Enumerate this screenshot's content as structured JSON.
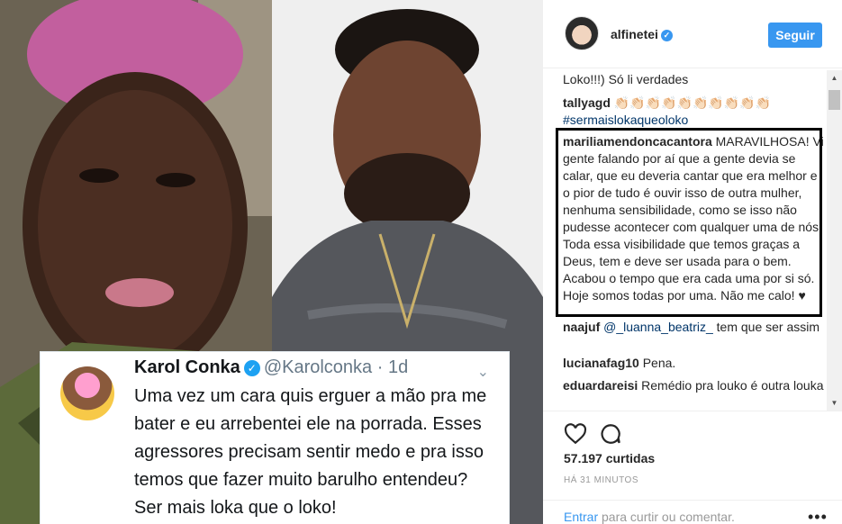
{
  "header": {
    "username": "alfinetei",
    "follow_label": "Seguir"
  },
  "tweet": {
    "name": "Karol Conka",
    "handle": "@Karolconka",
    "time": "· 1d",
    "text": "Uma vez um cara quis erguer a mão pra me bater e eu arrebentei ele na porrada. Esses agressores precisam sentir medo e pra isso temos que fazer muito barulho entendeu? Ser mais loka que o loko!"
  },
  "comments": [
    {
      "user": "",
      "text": "Loko!!!) Só li verdades"
    },
    {
      "user": "tallyagd",
      "text": "👏🏻👏🏻👏🏻👏🏻👏🏻👏🏻👏🏻👏🏻👏🏻👏🏻",
      "tag": "#sermaislokaqueoloko"
    },
    {
      "user": "mariliamendoncacantora",
      "text": "MARAVILHOSA! Vi gente falando por aí que a gente devia se calar, que eu deveria cantar que era melhor e o pior de tudo é ouvir isso de outra mulher, nenhuma sensibilidade, como se isso não pudesse acontecer com qualquer uma de nós! Toda essa visibilidade que temos graças a Deus, tem e deve ser usada para o bem. Acabou o tempo que era cada uma por si só. Hoje somos todas por uma. Não me calo! ♥"
    },
    {
      "user": "naajuf",
      "mention": "@_luanna_beatriz_",
      "text": " tem que ser assim"
    },
    {
      "user": "lucianafag10",
      "text": "Pena."
    },
    {
      "user": "eduardareisi",
      "text": "Remédio pra louko é outra louka"
    }
  ],
  "post": {
    "likes": "57.197 curtidas",
    "time": "HÁ 31 MINUTOS"
  },
  "login": {
    "link": "Entrar",
    "text": " para curtir ou comentar."
  },
  "colors": {
    "accent": "#3897f0",
    "link": "#003569",
    "twitter_blue": "#1da1f2"
  },
  "icons": {
    "like": "heart-icon",
    "comment": "comment-icon",
    "more": "more-options-icon"
  }
}
